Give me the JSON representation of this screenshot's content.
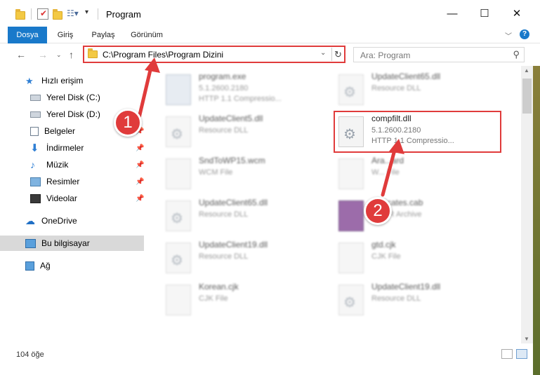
{
  "window": {
    "title": "Program",
    "controls": {
      "minimize": "—",
      "maximize": "☐",
      "close": "✕"
    }
  },
  "ribbon": {
    "tabs": [
      "Dosya",
      "Giriş",
      "Paylaş",
      "Görünüm"
    ],
    "help": "?"
  },
  "address": {
    "path": "C:\\Program Files\\Program Dizini",
    "search_placeholder": "Ara: Program"
  },
  "sidebar": {
    "items": [
      {
        "label": "Hızlı erişim",
        "icon": "star-icon"
      },
      {
        "label": "Yerel Disk (C:)",
        "icon": "drive-icon"
      },
      {
        "label": "Yerel Disk (D:)",
        "icon": "drive-icon"
      },
      {
        "label": "Belgeler",
        "icon": "documents-icon"
      },
      {
        "label": "İndirmeler",
        "icon": "download-icon"
      },
      {
        "label": "Müzik",
        "icon": "music-icon"
      },
      {
        "label": "Resimler",
        "icon": "pictures-icon"
      },
      {
        "label": "Videolar",
        "icon": "video-icon"
      },
      {
        "label": "OneDrive",
        "icon": "cloud-icon"
      },
      {
        "label": "Bu bilgisayar",
        "icon": "computer-icon"
      },
      {
        "label": "Ağ",
        "icon": "network-icon"
      }
    ]
  },
  "files": [
    {
      "name": "program.exe",
      "line1": "5.1.2600.2180",
      "line2": "HTTP 1.1 Compressio..."
    },
    {
      "name": "UpdateClient65.dll",
      "line1": "Resource DLL",
      "line2": ""
    },
    {
      "name": "UpdateClient5.dll",
      "line1": "Resource DLL",
      "line2": ""
    },
    {
      "name": "compfilt.dll",
      "line1": "5.1.2600.2180",
      "line2": "HTTP 1.1 Compressio..."
    },
    {
      "name": "SndToWP15.wcm",
      "line1": "WCM File",
      "line2": ""
    },
    {
      "name": "Ara...ard",
      "line1": "W... File",
      "line2": ""
    },
    {
      "name": "UpdateClient65.dll",
      "line1": "Resource DLL",
      "line2": ""
    },
    {
      "name": "...tificates.cab",
      "line1": "...RAR Archive",
      "line2": ""
    },
    {
      "name": "UpdateClient19.dll",
      "line1": "Resource DLL",
      "line2": ""
    },
    {
      "name": "gtd.cjk",
      "line1": "CJK File",
      "line2": ""
    },
    {
      "name": "Korean.cjk",
      "line1": "CJK File",
      "line2": ""
    },
    {
      "name": "UpdateClient19.dll",
      "line1": "Resource DLL",
      "line2": ""
    }
  ],
  "annotations": {
    "badge1": "1",
    "badge2": "2",
    "color": "#e03b3b"
  },
  "status": {
    "count": "104 öğe"
  },
  "colors": {
    "accent": "#1979ca",
    "highlight": "#e03b3b"
  }
}
